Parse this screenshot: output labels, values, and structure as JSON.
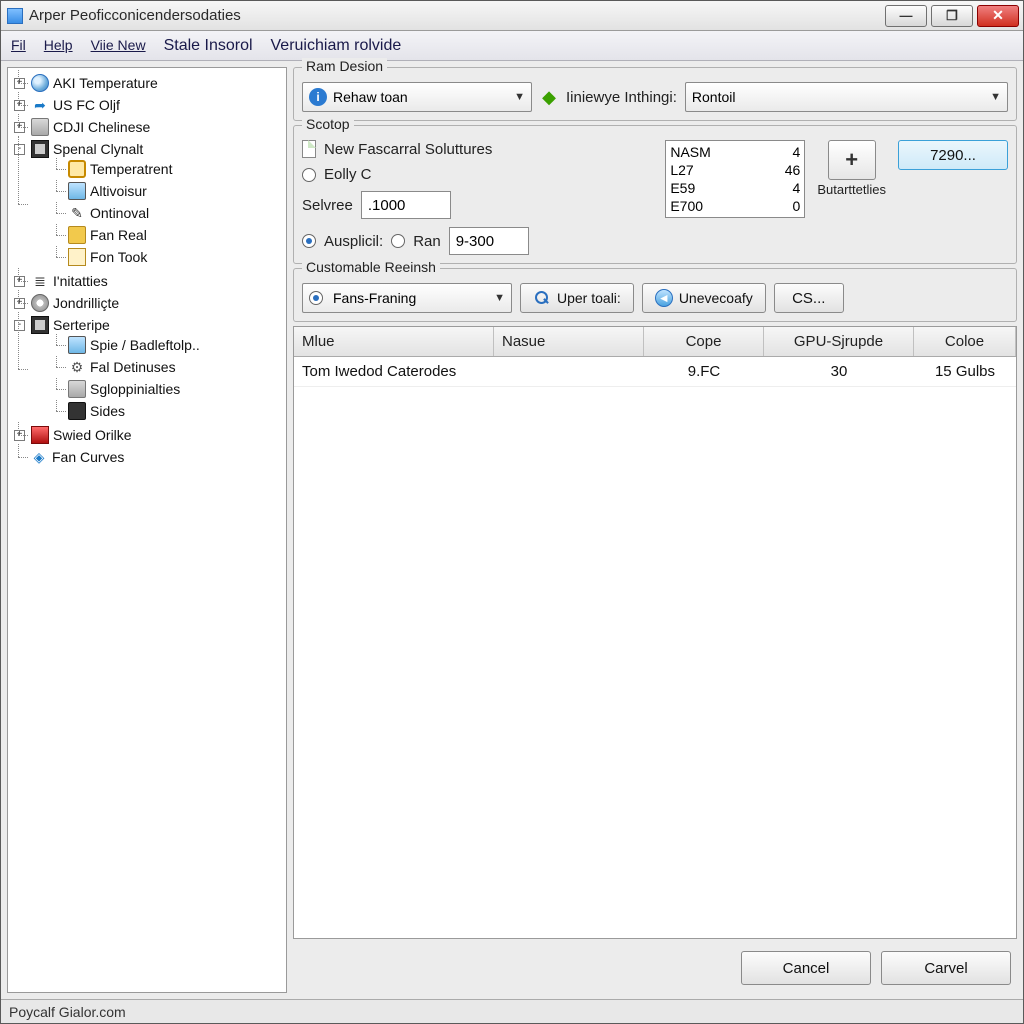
{
  "window": {
    "title": "Arper Peoficconicendersodaties"
  },
  "menubar": [
    "Fil",
    "Help",
    "Viie New",
    "Stale Insorol",
    "Veruichiam rolvide"
  ],
  "tree": [
    {
      "toggle": "+",
      "icon": "globe-icon",
      "label": "AKI Temperature"
    },
    {
      "toggle": "+",
      "icon": "arrow-icon",
      "label": "US FC Oljf"
    },
    {
      "toggle": "+",
      "icon": "drive-icon",
      "label": "CDJI Chelinese"
    },
    {
      "toggle": "-",
      "icon": "chip-icon",
      "label": "Spenal Clynalt",
      "children": [
        {
          "icon": "clock-icon",
          "label": "Temperatrent"
        },
        {
          "icon": "monitor-icon",
          "label": "Altivoisur"
        },
        {
          "icon": "pen-icon",
          "label": "Ontinoval"
        },
        {
          "icon": "folder-icon",
          "label": "Fan Real"
        },
        {
          "icon": "square-icon",
          "label": "Fon Took"
        }
      ]
    },
    {
      "toggle": "+",
      "icon": "bars-icon",
      "label": "I'nitatties"
    },
    {
      "toggle": "+",
      "icon": "disk-icon",
      "label": "Jondrilliçte"
    },
    {
      "toggle": "-",
      "icon": "chip-icon",
      "label": "Serteripe",
      "children": [
        {
          "icon": "monitor-icon",
          "label": "Spie / Badleftolp.."
        },
        {
          "icon": "gear-icon",
          "label": "Fal Detinuses"
        },
        {
          "icon": "drive-icon",
          "label": "Sgloppinialties"
        },
        {
          "icon": "phone-icon",
          "label": "Sides"
        }
      ]
    },
    {
      "toggle": "+",
      "icon": "red-icon",
      "label": "Swied Orilke"
    },
    {
      "toggle": "",
      "icon": "diamond-icon",
      "label": "Fan Curves"
    }
  ],
  "ram": {
    "legend": "Ram Desion",
    "combo_label": "Rehaw toan",
    "inthing_label": "Iiniewye Inthingi:",
    "inthing_value": "Rontoil"
  },
  "scotop": {
    "legend": "Scotop",
    "new_label": "New  Fascarral Soluttures",
    "eolly_label": "Eolly C",
    "selvree_label": "Selvree",
    "selvree_value": ".1000",
    "ausp_label": "Ausplicil:",
    "ran_label": "Ran",
    "ran_value": "9-300",
    "list": [
      {
        "k": "NASM",
        "v": "4"
      },
      {
        "k": "L27",
        "v": "46"
      },
      {
        "k": "E59",
        "v": "4"
      },
      {
        "k": "E700",
        "v": "0"
      }
    ],
    "plus_caption": "Butarttetlies",
    "hi_btn": "7290..."
  },
  "custom": {
    "legend": "Customable Reeinsh",
    "combo": "Fans-Franing",
    "uper": "Uper toali:",
    "unev": "Unevecoafy",
    "cs": "CS..."
  },
  "table": {
    "headers": [
      "Mlue",
      "Nasue",
      "Cope",
      "GPU-Sjrupde",
      "Coloe"
    ],
    "rows": [
      [
        "Tom Iwedod Caterodes",
        "",
        "9.FC",
        "30",
        "15 Gulbs"
      ]
    ]
  },
  "footer": {
    "cancel": "Cancel",
    "carvel": "Carvel"
  },
  "status": "Poycalf Gialor.com"
}
